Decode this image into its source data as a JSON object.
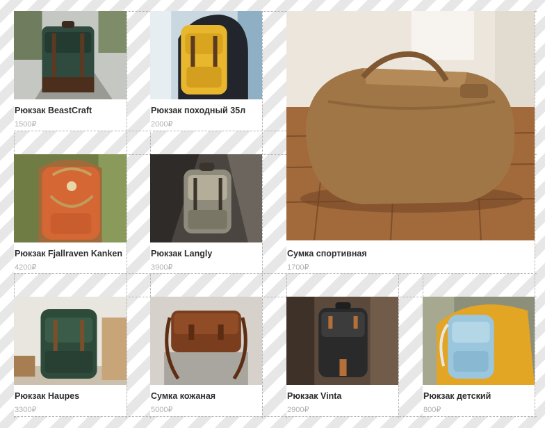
{
  "products": [
    {
      "title": "Рюкзак BeastCraft",
      "price": "1500₽",
      "image": "green-canvas-backpack-on-path"
    },
    {
      "title": "Рюкзак походный 35л",
      "price": "2000₽",
      "image": "yellow-backpack-on-person"
    },
    {
      "title": "Сумка спортивная",
      "price": "1700₽",
      "image": "brown-duffel-bag-on-wood-floor"
    },
    {
      "title": "Рюкзак Fjallraven Kanken",
      "price": "4200₽",
      "image": "orange-kanken-backpack"
    },
    {
      "title": "Рюкзак Langly",
      "price": "3900₽",
      "image": "grey-backpack-on-rock"
    },
    {
      "title": "Рюкзак Haupes",
      "price": "3300₽",
      "image": "green-backpack-by-crates"
    },
    {
      "title": "Сумка кожаная",
      "price": "5000₽",
      "image": "brown-leather-bag-on-stone"
    },
    {
      "title": "Рюкзак Vinta",
      "price": "2900₽",
      "image": "black-backpack-on-leaves"
    },
    {
      "title": "Рюкзак детский",
      "price": "800₽",
      "image": "light-blue-kids-backpack"
    }
  ]
}
